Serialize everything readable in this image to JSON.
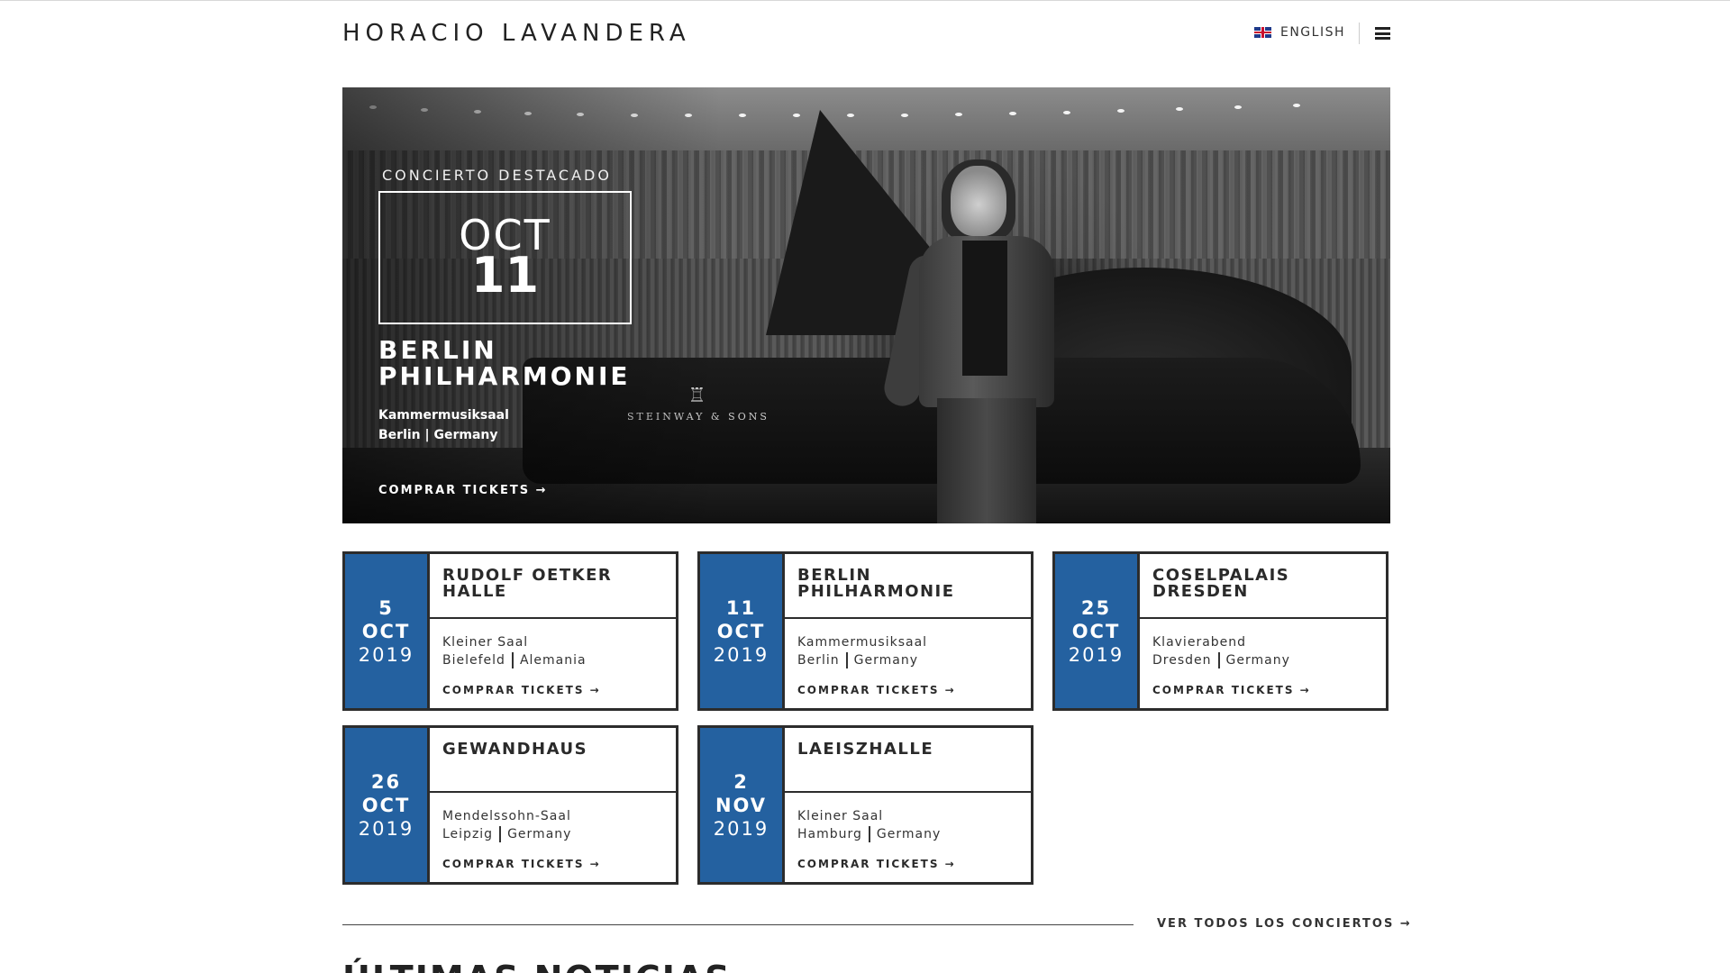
{
  "site": {
    "logo": "HORACIO LAVANDERA"
  },
  "header": {
    "language": "ENGLISH",
    "flag": "uk-flag-icon",
    "menu_icon": "hamburger-icon"
  },
  "hero": {
    "kicker": "CONCIERTO DESTACADO",
    "month": "OCT",
    "day": "11",
    "title_line1": "BERLIN",
    "title_line2": "PHILHARMONIE",
    "room": "Kammermusiksaal",
    "location": "Berlin | Germany",
    "cta": "COMPRAR TICKETS →",
    "piano_brand": "STEINWAY & SONS"
  },
  "concerts": [
    {
      "day": "5",
      "month": "OCT",
      "year": "2019",
      "title": "RUDOLF OETKER HALLE",
      "room": "Kleiner Saal",
      "city": "Bielefeld",
      "country": "Alemania",
      "cta": "COMPRAR TICKETS →"
    },
    {
      "day": "11",
      "month": "OCT",
      "year": "2019",
      "title": "BERLIN PHILHARMONIE",
      "room": "Kammermusiksaal",
      "city": "Berlin",
      "country": "Germany",
      "cta": "COMPRAR TICKETS →"
    },
    {
      "day": "25",
      "month": "OCT",
      "year": "2019",
      "title": "COSELPALAIS DRESDEN",
      "room": "Klavierabend",
      "city": "Dresden",
      "country": "Germany",
      "cta": "COMPRAR TICKETS →"
    },
    {
      "day": "26",
      "month": "OCT",
      "year": "2019",
      "title": "GEWANDHAUS",
      "room": "Mendelssohn-Saal",
      "city": "Leipzig",
      "country": "Germany",
      "cta": "COMPRAR TICKETS →"
    },
    {
      "day": "2",
      "month": "NOV",
      "year": "2019",
      "title": "LAEISZHALLE",
      "room": "Kleiner Saal",
      "city": "Hamburg",
      "country": "Germany",
      "cta": "COMPRAR TICKETS →"
    }
  ],
  "footer_links": {
    "all_concerts": "VER TODOS LOS CONCIERTOS →"
  },
  "news": {
    "title": "ÚLTIMAS NOTICIAS"
  },
  "colors": {
    "accent": "#2461a0",
    "border": "#2c2c2c"
  }
}
